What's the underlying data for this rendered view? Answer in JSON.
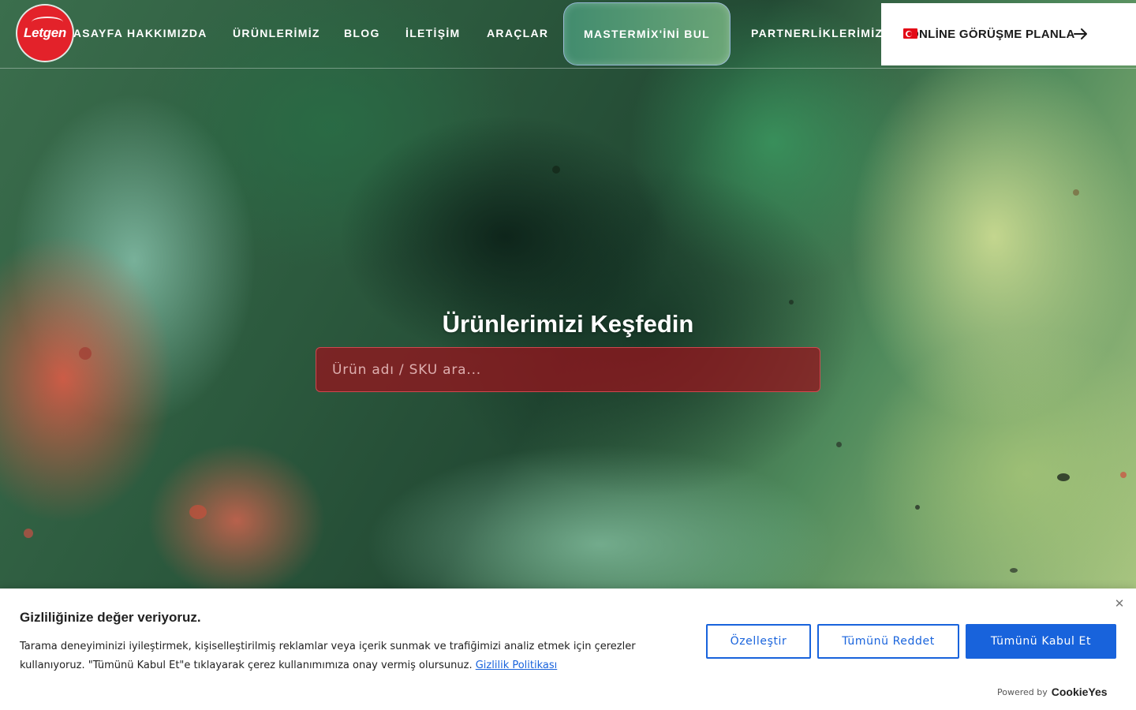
{
  "header": {
    "logo_text": "Letgen",
    "nav": [
      {
        "label": "ANASAYFA"
      },
      {
        "label": "HAKKIMIZDA"
      },
      {
        "label": "ÜRÜNLERİMİZ"
      },
      {
        "label": "BLOG"
      },
      {
        "label": "İLETİŞİM"
      },
      {
        "label": "ARAÇLAR"
      }
    ],
    "cta_label": "MASTERMİX'İNİ BUL",
    "partners_label": "PARTNERLİKLERİMİZ",
    "meeting_label": "ONLİNE GÖRÜŞME PLANLA"
  },
  "hero": {
    "title": "Ürünlerimizi Keşfedin",
    "search_placeholder": "Ürün adı / SKU ara..."
  },
  "cookie": {
    "title": "Gizliliğinize değer veriyoruz.",
    "text": "Tarama deneyiminizi iyileştirmek, kişiselleştirilmiş reklamlar veya içerik sunmak ve trafiğimizi analiz etmek için çerezler kullanıyoruz. \"Tümünü Kabul Et\"e tıklayarak çerez kullanımımıza onay vermiş olursunuz.",
    "policy_link": "Gizlilik Politikası",
    "customize_label": "Özelleştir",
    "reject_label": "Tümünü Reddet",
    "accept_label": "Tümünü Kabul Et",
    "powered_by": "Powered by",
    "powered_brand": "CookieYes"
  },
  "colors": {
    "brand_red": "#e3222a",
    "cookie_accent": "#1863dc"
  },
  "icons": [
    "arrow-right-icon",
    "close-icon",
    "turkey-flag-icon"
  ]
}
